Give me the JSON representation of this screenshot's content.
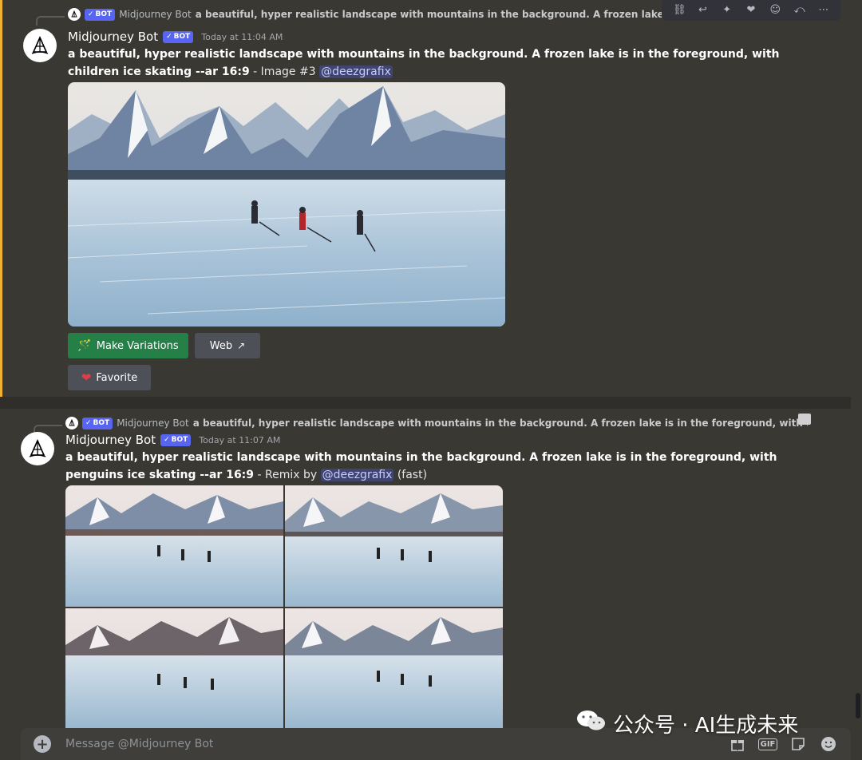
{
  "toolbar": {
    "icons": [
      "link-icon",
      "reply-icon",
      "star-icon",
      "heart-icon",
      "emoji-icon",
      "thread-icon",
      "more-icon"
    ]
  },
  "messages": [
    {
      "reply": {
        "author": "Midjourney Bot",
        "bot_label": "BOT",
        "text": "a beautiful, hyper realistic landscape with mountains in the background. A frozen lake is in the foreground, with children ice"
      },
      "author": "Midjourney Bot",
      "bot_label": "BOT",
      "timestamp": "Today at 11:04 AM",
      "prompt": "a beautiful, hyper realistic landscape with mountains in the background. A frozen lake is in the foreground, with children ice skating --ar 16:9",
      "suffix": " - Image #3 ",
      "mention": "@deezgrafix",
      "buttons": {
        "make_variations": "Make Variations",
        "web": "Web",
        "favorite": "Favorite"
      }
    },
    {
      "reply": {
        "author": "Midjourney Bot",
        "bot_label": "BOT",
        "text": "a beautiful, hyper realistic landscape with mountains in the background. A frozen lake is in the foreground, with children ic"
      },
      "author": "Midjourney Bot",
      "bot_label": "BOT",
      "timestamp": "Today at 11:07 AM",
      "prompt": "a beautiful, hyper realistic landscape with mountains in the background. A frozen lake is in the foreground, with penguins ice skating --ar 16:9",
      "suffix": " - Remix by ",
      "mention": "@deezgrafix",
      "speed": " (fast)"
    }
  ],
  "composer": {
    "placeholder": "Message @Midjourney Bot",
    "gif_label": "GIF"
  },
  "watermark": {
    "text": "公众号 · AI生成未来"
  }
}
